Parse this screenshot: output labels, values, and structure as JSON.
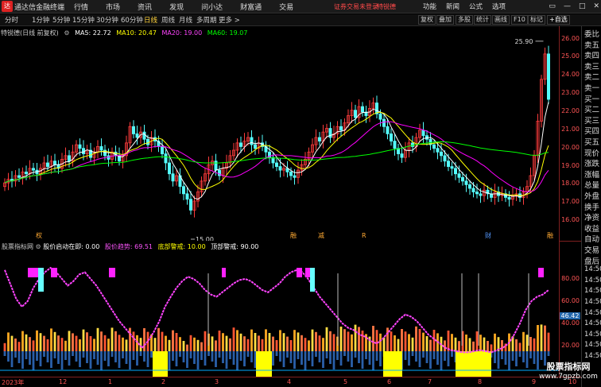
{
  "app": {
    "title": "通达信金融终端",
    "logo": "达"
  },
  "menu": [
    "行情",
    "市场",
    "资讯",
    "发现",
    "问小达",
    "财富通",
    "交易"
  ],
  "notice": "证券交易未登录",
  "stock_name": "特锐德",
  "right_menu": [
    "功能",
    "新闻",
    "公式",
    "选项"
  ],
  "window_btns": [
    "▭",
    "—",
    "□",
    "✕"
  ],
  "periods": [
    "分时",
    "1分钟",
    "5分钟",
    "15分钟",
    "30分钟",
    "60分钟",
    "日线",
    "周线",
    "月线",
    "多周期",
    "更多 >"
  ],
  "active_period": "日线",
  "right_tools": [
    "复权",
    "叠加",
    "多股",
    "统计",
    "画线",
    "F10",
    "标记",
    "+自选"
  ],
  "chart_title": "特锐德(日线 前复权)",
  "ma": {
    "ma5": "MA5: 22.72",
    "ma10": "MA10: 20.47",
    "ma20": "MA20: 19.00",
    "ma60": "MA60: 19.07",
    "colors": {
      "ma5": "#ffffff",
      "ma10": "#ffff00",
      "ma20": "#ff00ff",
      "ma60": "#00ff00"
    }
  },
  "price_axis": [
    "26.00",
    "25.00",
    "24.00",
    "23.00",
    "22.00",
    "21.00",
    "20.00",
    "19.00",
    "18.00",
    "17.00",
    "16.00"
  ],
  "annotations": {
    "high": "25.90",
    "low": "15.00"
  },
  "event_marks": [
    "权",
    "融",
    "减",
    "R",
    "财",
    "融"
  ],
  "right_panel": [
    "委比",
    "卖五",
    "卖四",
    "卖三",
    "卖二",
    "卖一",
    "买一",
    "买二",
    "买三",
    "买四",
    "买五",
    "现价",
    "涨跌",
    "涨幅",
    "总量",
    "外盘",
    "换手",
    "净资",
    "收益",
    "自动",
    "交易",
    "盘后",
    "14:50",
    "14:50",
    "14:50",
    "14:50",
    "14:50",
    "14:50",
    "14:50",
    "14:50",
    "14:50"
  ],
  "indicator": {
    "name": "股票指标网",
    "items": [
      {
        "text": "股价启动在即: 0.00",
        "color": "#ffffff"
      },
      {
        "text": "股价趋势: 69.51",
        "color": "#ff55ff"
      },
      {
        "text": "底部警戒: 10.00",
        "color": "#ffff00"
      },
      {
        "text": "顶部警戒: 90.00",
        "color": "#ffffff"
      }
    ],
    "axis": [
      "80.00",
      "60.00",
      "40.00",
      "20.00"
    ],
    "current": "46.42"
  },
  "x_axis": [
    "2023年",
    "12",
    "1",
    "2",
    "3",
    "4",
    "5",
    "6",
    "7",
    "8",
    "9",
    "10"
  ],
  "watermark": {
    "line1": "股票指标网",
    "line2": "www.7gpzb.com"
  },
  "chart_data": {
    "type": "candlestick",
    "title": "特锐德(日线 前复权)",
    "ylim": [
      15,
      26.2
    ],
    "closes": [
      18.1,
      18.3,
      18.2,
      18.5,
      18.4,
      18.7,
      18.6,
      18.9,
      18.8,
      18.6,
      18.9,
      19.2,
      19.0,
      19.3,
      19.1,
      18.9,
      19.4,
      19.6,
      19.3,
      19.8,
      20.2,
      20.0,
      19.7,
      19.9,
      19.5,
      19.8,
      20.1,
      19.9,
      19.6,
      19.4,
      19.8,
      19.6,
      19.3,
      19.6,
      20.3,
      21.2,
      20.8,
      20.6,
      20.9,
      20.5,
      20.2,
      20.6,
      20.4,
      20.1,
      19.7,
      19.2,
      18.6,
      18.2,
      18.5,
      17.9,
      17.5,
      17.2,
      16.6,
      17.1,
      17.6,
      18.2,
      18.6,
      19.1,
      19.3,
      18.8,
      18.5,
      18.9,
      19.2,
      19.6,
      19.9,
      20.3,
      20.1,
      20.4,
      20.6,
      20.2,
      20.0,
      20.3,
      20.1,
      19.8,
      19.5,
      19.2,
      19.0,
      18.8,
      18.9,
      18.7,
      18.5,
      18.4,
      18.8,
      19.1,
      19.4,
      19.8,
      20.2,
      20.6,
      20.4,
      20.9,
      21.1,
      20.6,
      20.8,
      21.2,
      21.0,
      21.4,
      21.8,
      22.1,
      21.7,
      22.3,
      22.0,
      21.8,
      22.2,
      22.5,
      21.9,
      21.6,
      21.2,
      20.8,
      20.4,
      20.0,
      19.7,
      19.5,
      19.9,
      20.3,
      20.1,
      20.6,
      21.0,
      20.7,
      20.5,
      20.2,
      20.0,
      19.8,
      19.6,
      19.3,
      19.0,
      18.9,
      18.6,
      18.4,
      18.2,
      18.0,
      17.8,
      17.6,
      17.5,
      17.4,
      17.7,
      17.5,
      17.3,
      17.6,
      17.4,
      17.5,
      17.3,
      17.2,
      17.4,
      17.5,
      17.3,
      17.6,
      17.9,
      18.5,
      19.6,
      21.5,
      23.8,
      25.2,
      22.7
    ],
    "ma5_last": 22.72,
    "ma10_last": 20.47,
    "ma20_last": 19.0,
    "ma60_last": 19.07,
    "trend": [
      88,
      75,
      62,
      55,
      60,
      72,
      80,
      86,
      90,
      86,
      80,
      74,
      78,
      84,
      86,
      80,
      74,
      66,
      58,
      50,
      42,
      36,
      30,
      24,
      18,
      24,
      32,
      42,
      55,
      64,
      72,
      78,
      82,
      80,
      76,
      70,
      66,
      64,
      68,
      72,
      76,
      79,
      80,
      78,
      74,
      70,
      68,
      72,
      76,
      82,
      86,
      88,
      86,
      80,
      72,
      64,
      58,
      52,
      46,
      40,
      36,
      34,
      30,
      28,
      24,
      22,
      26,
      32,
      38,
      44,
      48,
      46,
      42,
      36,
      30,
      26,
      22,
      18,
      16,
      15,
      14,
      14,
      15,
      16,
      15,
      14,
      16,
      18,
      22,
      30,
      40,
      52,
      60,
      64,
      66,
      70
    ]
  }
}
